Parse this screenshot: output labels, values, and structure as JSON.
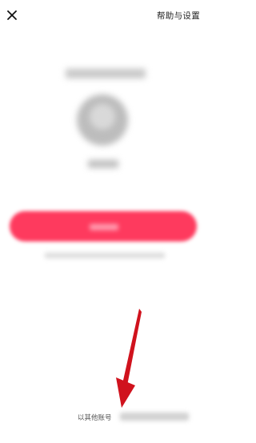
{
  "topbar": {
    "close_icon": "close-icon",
    "help_label": "帮助与设置"
  },
  "footer": {
    "other_account_label": "以其他账号"
  },
  "colors": {
    "primary_button": "#fe3a5e",
    "annotation_arrow": "#d0121d"
  }
}
